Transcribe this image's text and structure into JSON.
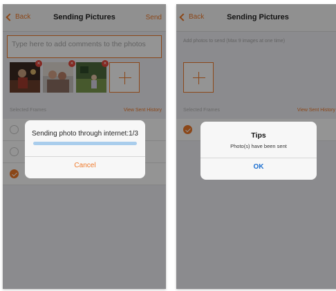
{
  "left_screen": {
    "nav": {
      "back": "Back",
      "title": "Sending Pictures",
      "send": "Send"
    },
    "comment_placeholder": "Type here to add comments to the photos",
    "thumbnails": [
      {
        "icon": "photo-thumbnail",
        "delete_glyph": "×"
      },
      {
        "icon": "photo-thumbnail",
        "delete_glyph": "×"
      },
      {
        "icon": "photo-thumbnail",
        "delete_glyph": "×"
      }
    ],
    "section_label": "Selected Frames",
    "history_link": "View Sent History",
    "frames": [
      {
        "selected": false
      },
      {
        "selected": false
      },
      {
        "selected": true
      }
    ],
    "dialog": {
      "message": "Sending photo through internet:1/3",
      "progress": 1.0,
      "cancel": "Cancel"
    }
  },
  "right_screen": {
    "nav": {
      "back": "Back",
      "title": "Sending Pictures"
    },
    "add_hint": "Add photos to send (Max 9 images at one time)",
    "section_label": "Selected Frames",
    "history_link": "View Sent History",
    "frames": [
      {
        "selected": true
      }
    ],
    "dialog": {
      "title": "Tips",
      "message": "Photo(s) have been sent",
      "ok": "OK"
    }
  },
  "colors": {
    "accent": "#f07a2a",
    "link_blue": "#1c6fd0",
    "delete_red": "#e4453a"
  }
}
